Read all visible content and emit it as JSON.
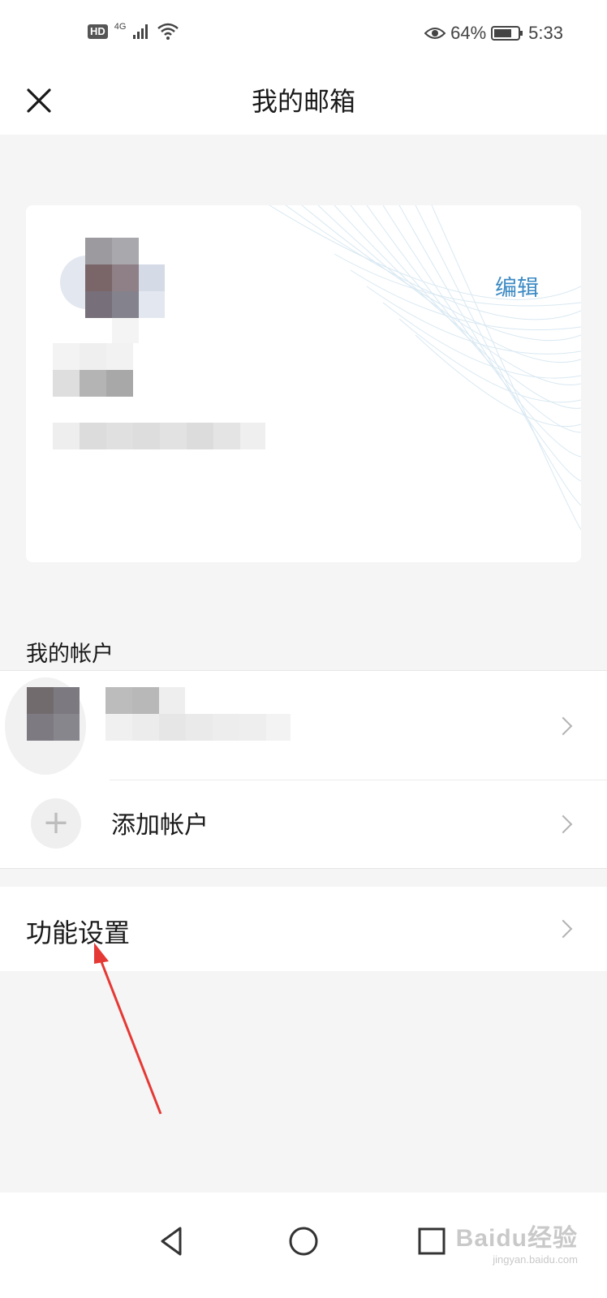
{
  "status_bar": {
    "hd": "HD",
    "network": "4G",
    "battery_percent": "64%",
    "time": "5:33",
    "icons": [
      "signal-icon",
      "wifi-icon",
      "eye-icon",
      "battery-icon"
    ]
  },
  "header": {
    "title": "我的邮箱",
    "close_icon": "close-icon"
  },
  "profile_card": {
    "edit_label": "编辑"
  },
  "accounts_section": {
    "label": "我的帐户",
    "add_account_label": "添加帐户",
    "add_icon": "plus-icon"
  },
  "settings": {
    "label": "功能设置"
  },
  "watermark": {
    "main": "Baidu经验",
    "sub": "jingyan.baidu.com"
  },
  "colors": {
    "accent": "#3d8bc4",
    "background": "#f5f5f5",
    "annotation_arrow": "#e53935"
  }
}
